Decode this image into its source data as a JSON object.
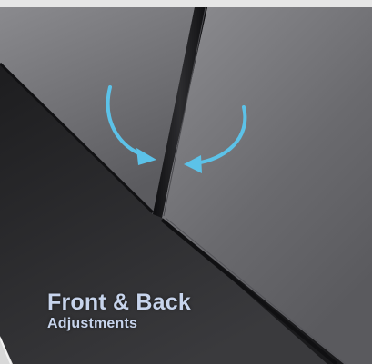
{
  "caption": {
    "title": "Front & Back",
    "subtitle": "Adjustments"
  },
  "colors": {
    "arrow": "#5cc2e8",
    "caption_text": "#c7d4ec",
    "upper_panel": "#7c7c80",
    "lower_panel": "#3a3a3c"
  },
  "icons": {
    "left_arrow": "curved-arrow-pointing-right-down",
    "right_arrow": "curved-arrow-pointing-left-down"
  }
}
